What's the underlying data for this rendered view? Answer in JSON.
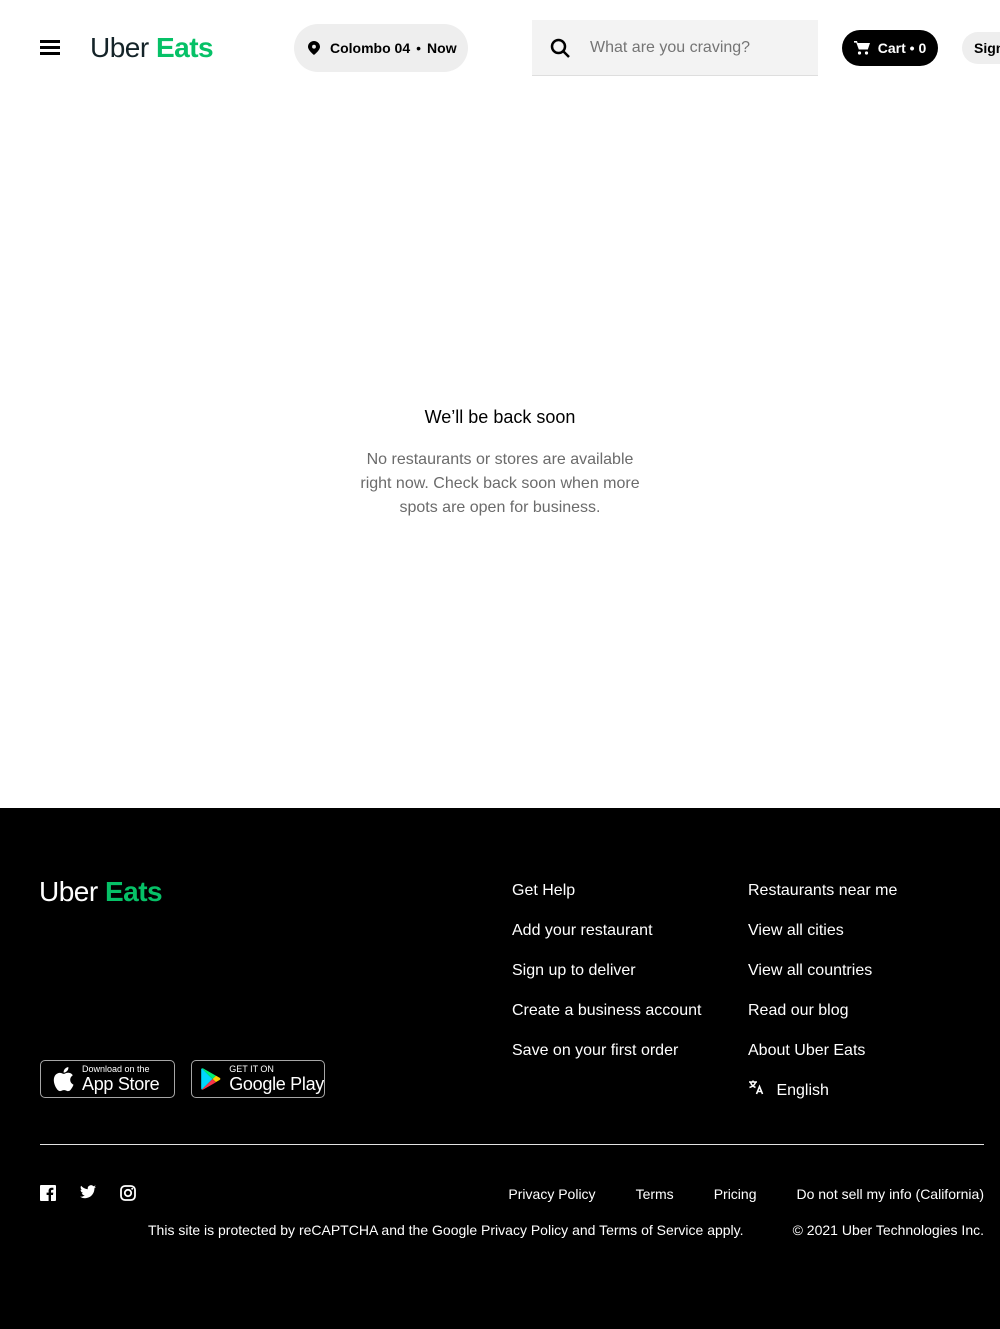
{
  "header": {
    "logo_uber": "Uber",
    "logo_eats": "Eats",
    "location": "Colombo 04",
    "location_separator": "•",
    "delivery_time": "Now",
    "search_placeholder": "What are you craving?",
    "cart_label": "Cart • 0",
    "signin_label": "Sign in"
  },
  "main": {
    "title": "We’ll be back soon",
    "message": "No restaurants or stores are available right now. Check back soon when more spots are open for business."
  },
  "footer": {
    "logo_uber": "Uber",
    "logo_eats": "Eats",
    "app_store": {
      "small": "Download on the",
      "big": "App Store"
    },
    "google_play": {
      "small": "GET IT ON",
      "big": "Google Play"
    },
    "links_col1": [
      "Get Help",
      "Add your restaurant",
      "Sign up to deliver",
      "Create a business account",
      "Save on your first order"
    ],
    "links_col2": [
      "Restaurants near me",
      "View all cities",
      "View all countries",
      "Read our blog",
      "About Uber Eats"
    ],
    "language": "English",
    "social_icons": [
      "facebook-icon",
      "twitter-icon",
      "instagram-icon"
    ],
    "legal_links": [
      "Privacy Policy",
      "Terms",
      "Pricing",
      "Do not sell my info (California)"
    ],
    "recaptcha": "This site is protected by reCAPTCHA and the Google Privacy Policy and Terms of Service apply.",
    "copyright": "© 2021 Uber Technologies Inc."
  },
  "colors": {
    "brand_green": "#06c167",
    "logo_dark": "#142328",
    "footer_bg": "#000000"
  }
}
